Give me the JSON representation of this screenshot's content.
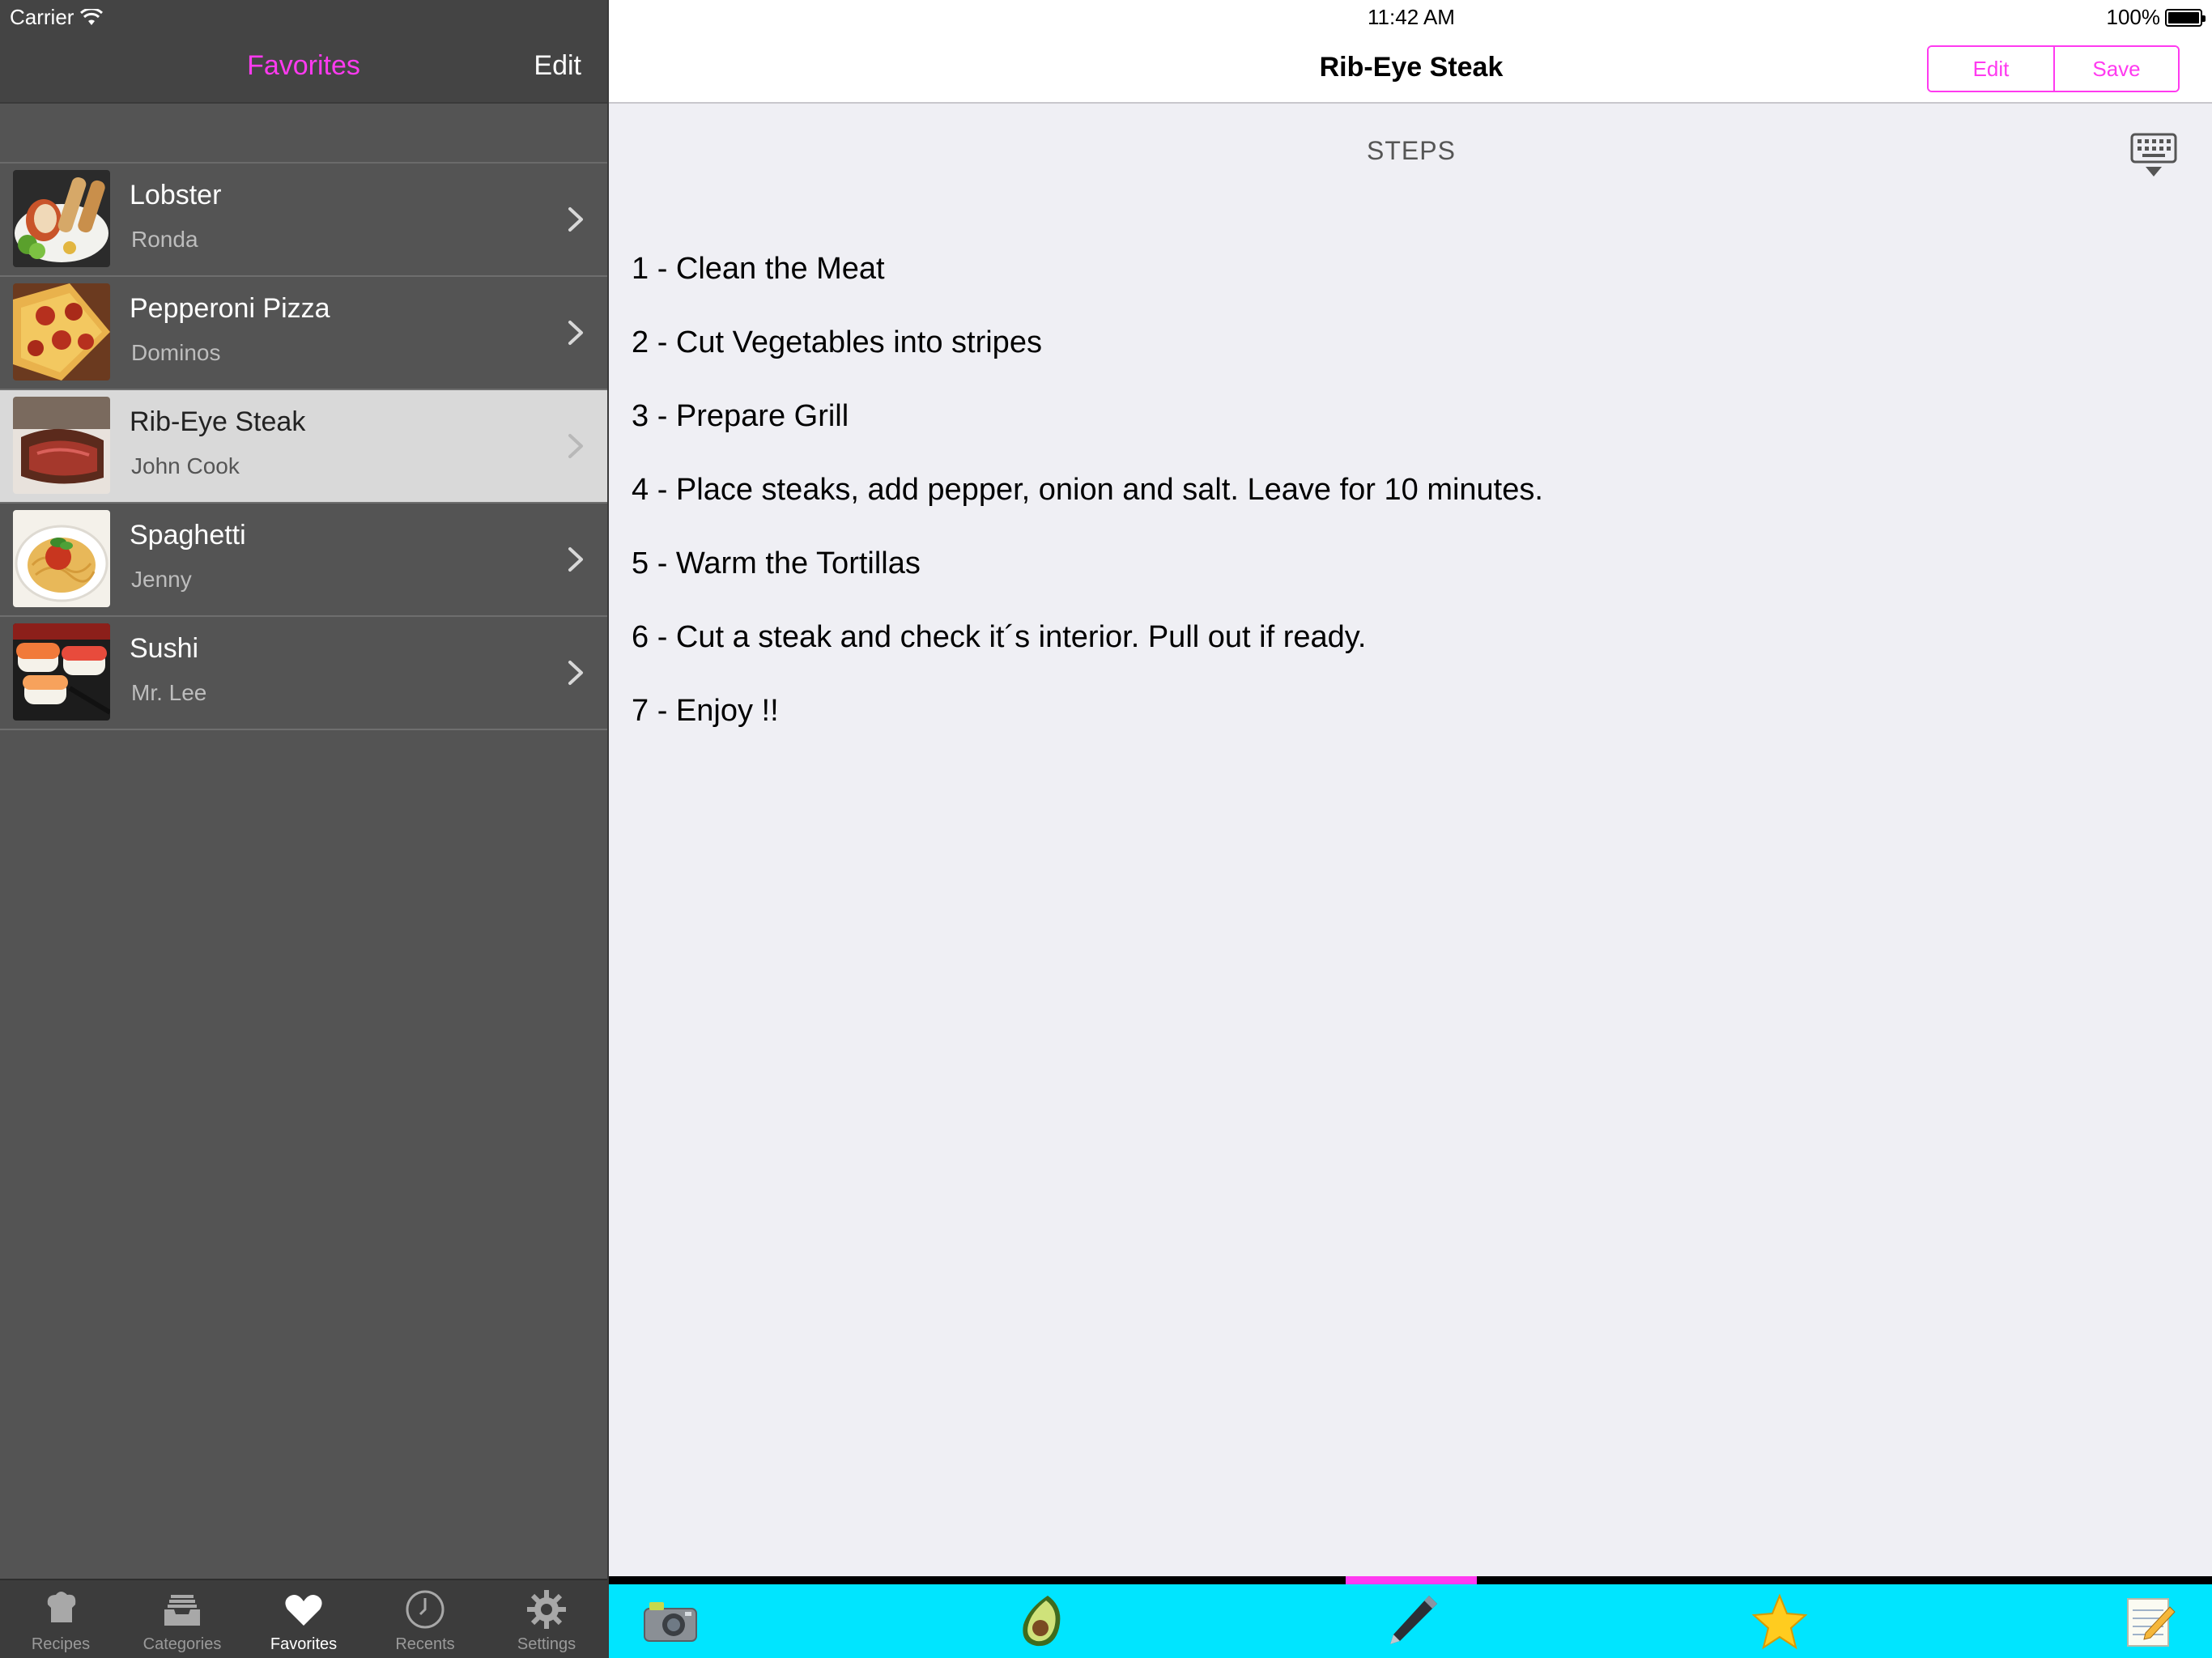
{
  "status_bar": {
    "carrier": "Carrier",
    "time": "11:42 AM",
    "battery": "100%"
  },
  "master": {
    "title": "Favorites",
    "edit_label": "Edit",
    "items": [
      {
        "title": "Lobster",
        "subtitle": "Ronda",
        "selected": false
      },
      {
        "title": "Pepperoni Pizza",
        "subtitle": "Dominos",
        "selected": false
      },
      {
        "title": "Rib-Eye Steak",
        "subtitle": "John Cook",
        "selected": true
      },
      {
        "title": "Spaghetti",
        "subtitle": "Jenny",
        "selected": false
      },
      {
        "title": "Sushi",
        "subtitle": "Mr. Lee",
        "selected": false
      }
    ]
  },
  "tabbar": {
    "tabs": [
      {
        "label": "Recipes",
        "icon": "chef-hat-icon",
        "active": false
      },
      {
        "label": "Categories",
        "icon": "inbox-tray-icon",
        "active": false
      },
      {
        "label": "Favorites",
        "icon": "heart-icon",
        "active": true
      },
      {
        "label": "Recents",
        "icon": "clock-icon",
        "active": false
      },
      {
        "label": "Settings",
        "icon": "gear-icon",
        "active": false
      }
    ]
  },
  "detail": {
    "title": "Rib-Eye Steak",
    "edit_label": "Edit",
    "save_label": "Save",
    "section_heading": "STEPS",
    "steps": [
      "1 - Clean the Meat",
      "2 - Cut Vegetables into stripes",
      "3 - Prepare Grill",
      "4 - Place steaks, add pepper, onion and salt. Leave for 10 minutes.",
      "5 - Warm the Tortillas",
      "6 - Cut a steak and check it´s interior. Pull out if ready.",
      "7 - Enjoy !!"
    ]
  },
  "toolbar": {
    "items": [
      "camera-icon",
      "avocado-icon",
      "pen-icon",
      "star-icon",
      "notepad-icon"
    ],
    "active_index": 2
  },
  "colors": {
    "accent": "#ff3af0",
    "toolbar_bg": "#00e5ff",
    "master_bg": "#545454"
  }
}
